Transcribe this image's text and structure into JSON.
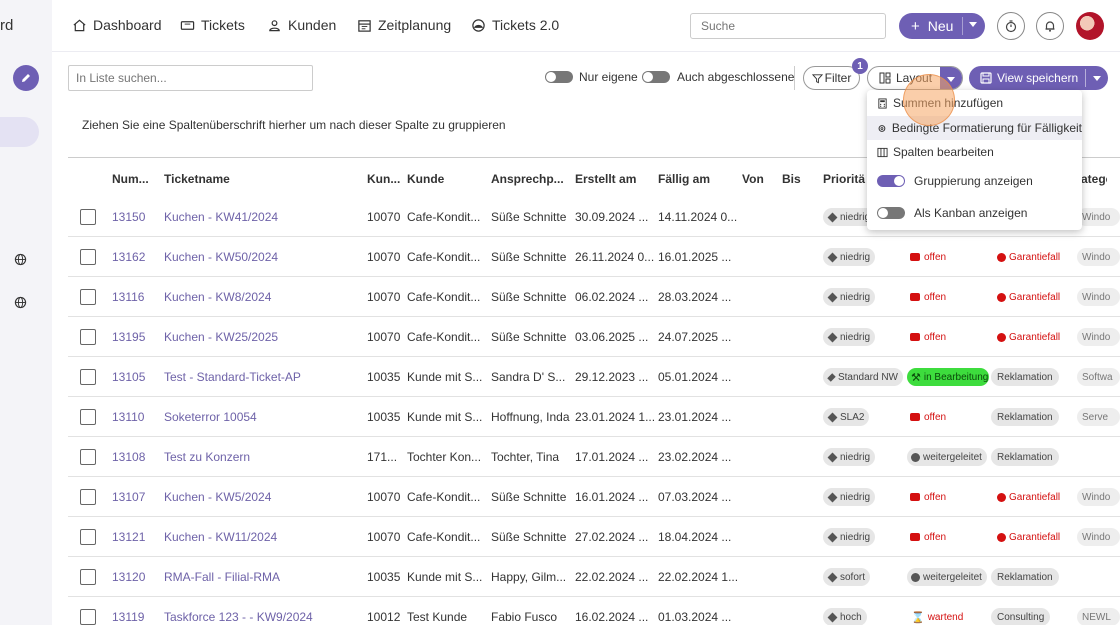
{
  "sidebar": {
    "partial_title": "rd"
  },
  "nav": {
    "items": [
      {
        "label": "Dashboard",
        "icon": "home-icon"
      },
      {
        "label": "Tickets",
        "icon": "ticket-icon"
      },
      {
        "label": "Kunden",
        "icon": "person-icon"
      },
      {
        "label": "Zeitplanung",
        "icon": "calendar-icon"
      },
      {
        "label": "Tickets 2.0",
        "icon": "gauge-icon"
      }
    ]
  },
  "header": {
    "search_placeholder": "Suche",
    "new_label": "Neu"
  },
  "toolbar": {
    "list_search_placeholder": "In Liste suchen...",
    "toggle_own": "Nur eigene",
    "toggle_closed": "Auch abgeschlossene",
    "filter_label": "Filter",
    "filter_count": "1",
    "layout_label": "Layout",
    "save_view_label": "View speichern"
  },
  "group_hint": "Ziehen Sie eine Spaltenüberschrift hierher um nach dieser Spalte zu gruppieren",
  "columns": [
    "Num...",
    "Ticketname",
    "Kun...",
    "Kunde",
    "Ansprechp...",
    "Erstellt am",
    "Fällig am",
    "Von",
    "Bis",
    "Prioritä",
    "ategc"
  ],
  "layout_menu": {
    "items": [
      "Summen hinzufügen",
      "Bedingte Formatierung für Fälligkeit",
      "Spalten bearbeiten"
    ],
    "toggle_group": "Gruppierung anzeigen",
    "toggle_kanban": "Als Kanban anzeigen"
  },
  "rows": [
    {
      "num": "13150",
      "name": "Kuchen - KW41/2024",
      "kun": "10070",
      "kunde": "Cafe-Kondit...",
      "ansp": "Süße Schnitte",
      "erstellt": "30.09.2024 ...",
      "faellig": "14.11.2024 0...",
      "prio": "niedrig",
      "status": "",
      "cat": "",
      "extra": "Windo"
    },
    {
      "num": "13162",
      "name": "Kuchen - KW50/2024",
      "kun": "10070",
      "kunde": "Cafe-Kondit...",
      "ansp": "Süße Schnitte",
      "erstellt": "26.11.2024 0...",
      "faellig": "16.01.2025 ...",
      "prio": "niedrig",
      "status": "offen",
      "cat": "Garantiefall",
      "extra": "Windo"
    },
    {
      "num": "13116",
      "name": "Kuchen - KW8/2024",
      "kun": "10070",
      "kunde": "Cafe-Kondit...",
      "ansp": "Süße Schnitte",
      "erstellt": "06.02.2024 ...",
      "faellig": "28.03.2024 ...",
      "prio": "niedrig",
      "status": "offen",
      "cat": "Garantiefall",
      "extra": "Windo"
    },
    {
      "num": "13195",
      "name": "Kuchen - KW25/2025",
      "kun": "10070",
      "kunde": "Cafe-Kondit...",
      "ansp": "Süße Schnitte",
      "erstellt": "03.06.2025 ...",
      "faellig": "24.07.2025 ...",
      "prio": "niedrig",
      "status": "offen",
      "cat": "Garantiefall",
      "extra": "Windo"
    },
    {
      "num": "13105",
      "name": "Test - Standard-Ticket-AP",
      "kun": "10035",
      "kunde": "Kunde mit S...",
      "ansp": "Sandra D' S...",
      "erstellt": "29.12.2023 ...",
      "faellig": "05.01.2024 ...",
      "prio": "Standard NW",
      "status": "in Bearbeitung",
      "cat": "Reklamation",
      "extra": "Softwa"
    },
    {
      "num": "13110",
      "name": "Soketerror 10054",
      "kun": "10035",
      "kunde": "Kunde mit S...",
      "ansp": "Hoffnung, Inda",
      "erstellt": "23.01.2024 1...",
      "faellig": "23.01.2024 ...",
      "prio": "SLA2",
      "status": "offen",
      "cat": "Reklamation",
      "extra": "Serve"
    },
    {
      "num": "13108",
      "name": "Test zu Konzern",
      "kun": "171...",
      "kunde": "Tochter Kon...",
      "ansp": "Tochter, Tina",
      "erstellt": "17.01.2024 ...",
      "faellig": "23.02.2024 ...",
      "prio": "niedrig",
      "status": "weitergeleitet",
      "cat": "Reklamation",
      "extra": ""
    },
    {
      "num": "13107",
      "name": "Kuchen - KW5/2024",
      "kun": "10070",
      "kunde": "Cafe-Kondit...",
      "ansp": "Süße Schnitte",
      "erstellt": "16.01.2024 ...",
      "faellig": "07.03.2024 ...",
      "prio": "niedrig",
      "status": "offen",
      "cat": "Garantiefall",
      "extra": "Windo"
    },
    {
      "num": "13121",
      "name": "Kuchen - KW11/2024",
      "kun": "10070",
      "kunde": "Cafe-Kondit...",
      "ansp": "Süße Schnitte",
      "erstellt": "27.02.2024 ...",
      "faellig": "18.04.2024 ...",
      "prio": "niedrig",
      "status": "offen",
      "cat": "Garantiefall",
      "extra": "Windo"
    },
    {
      "num": "13120",
      "name": "RMA-Fall - Filial-RMA",
      "kun": "10035",
      "kunde": "Kunde mit S...",
      "ansp": "Happy, Gilm...",
      "erstellt": "22.02.2024 ...",
      "faellig": "22.02.2024 1...",
      "prio": "sofort",
      "status": "weitergeleitet",
      "cat": "Reklamation",
      "extra": ""
    },
    {
      "num": "13119",
      "name": "Taskforce 123 - - KW9/2024",
      "kun": "10012",
      "kunde": "Test Kunde",
      "ansp": "Fabio Fusco",
      "erstellt": "16.02.2024 ...",
      "faellig": "01.03.2024 ...",
      "prio": "hoch",
      "status": "wartend",
      "cat": "Consulting",
      "extra": "NEWL"
    }
  ]
}
